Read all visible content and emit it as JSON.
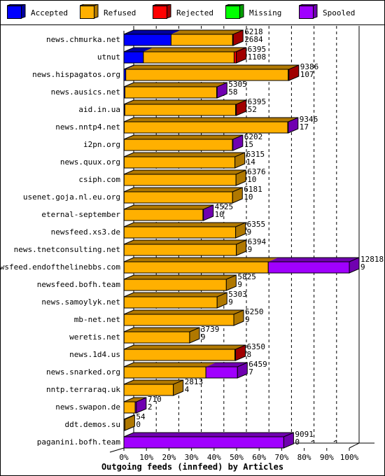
{
  "legend": [
    {
      "name": "Accepted",
      "color": "#0000ff",
      "side": "#0000a0"
    },
    {
      "name": "Refused",
      "color": "#ffb000",
      "side": "#b07800"
    },
    {
      "name": "Rejected",
      "color": "#ff0000",
      "side": "#a00000"
    },
    {
      "name": "Missing",
      "color": "#00ff00",
      "side": "#00a000"
    },
    {
      "name": "Spooled",
      "color": "#a000ff",
      "side": "#7000b0"
    }
  ],
  "chart_data": {
    "type": "bar",
    "orientation": "horizontal",
    "stacked": true,
    "style": "3d",
    "title": "",
    "xlabel": "Outgoing feeds (innfeed) by Articles",
    "ylabel": "",
    "xlim_percent": [
      0,
      100
    ],
    "x_ticks": [
      "0%",
      "10%",
      "20%",
      "30%",
      "40%",
      "50%",
      "60%",
      "70%",
      "80%",
      "90%",
      "100%"
    ],
    "scale_max": 12818,
    "legend_position": "top",
    "grid": "dashed vertical",
    "categories": [
      "news.chmurka.net",
      "utnut",
      "news.hispagatos.org",
      "news.ausics.net",
      "aid.in.ua",
      "news.nntp4.net",
      "i2pn.org",
      "news.quux.org",
      "csiph.com",
      "usenet.goja.nl.eu.org",
      "eternal-september",
      "newsfeed.xs3.de",
      "news.tnetconsulting.net",
      "newsfeed.endofthelinebbs.com",
      "newsfeed.bofh.team",
      "news.samoylyk.net",
      "mb-net.net",
      "weretis.net",
      "news.1d4.us",
      "news.snarked.org",
      "nntp.terraraq.uk",
      "news.swapon.de",
      "ddt.demos.su",
      "paganini.bofh.team"
    ],
    "totals": [
      6218,
      6395,
      9386,
      5305,
      6395,
      9346,
      6202,
      6315,
      6376,
      6181,
      4525,
      6355,
      6394,
      12818,
      5825,
      5303,
      6250,
      3739,
      6350,
      6459,
      2813,
      710,
      54,
      9091
    ],
    "accepted_labels": [
      2684,
      1108,
      107,
      58,
      52,
      17,
      15,
      14,
      10,
      10,
      10,
      9,
      9,
      9,
      9,
      9,
      9,
      9,
      8,
      7,
      4,
      2,
      0,
      0
    ],
    "series": [
      {
        "name": "Accepted",
        "values": [
          2684,
          1108,
          107,
          58,
          52,
          17,
          15,
          14,
          10,
          10,
          10,
          9,
          9,
          9,
          9,
          9,
          9,
          9,
          8,
          7,
          4,
          2,
          0,
          0
        ]
      },
      {
        "name": "Refused",
        "values": [
          3500,
          5160,
          9239,
          5217,
          6303,
          9299,
          6157,
          6301,
          6366,
          6171,
          4485,
          6346,
          6385,
          8200,
          5816,
          5294,
          6241,
          3730,
          6302,
          4657,
          2809,
          640,
          54,
          0
        ]
      },
      {
        "name": "Rejected",
        "values": [
          34,
          127,
          40,
          0,
          40,
          0,
          0,
          0,
          0,
          0,
          0,
          0,
          0,
          0,
          0,
          0,
          0,
          0,
          40,
          0,
          0,
          0,
          0,
          0
        ]
      },
      {
        "name": "Missing",
        "values": [
          0,
          0,
          0,
          0,
          0,
          0,
          0,
          0,
          0,
          0,
          0,
          0,
          0,
          0,
          0,
          0,
          0,
          0,
          0,
          0,
          0,
          0,
          0,
          0
        ]
      },
      {
        "name": "Spooled",
        "values": [
          0,
          0,
          0,
          30,
          0,
          30,
          30,
          0,
          0,
          0,
          30,
          0,
          0,
          4609,
          0,
          0,
          0,
          0,
          0,
          1795,
          0,
          68,
          0,
          9091
        ]
      }
    ]
  }
}
